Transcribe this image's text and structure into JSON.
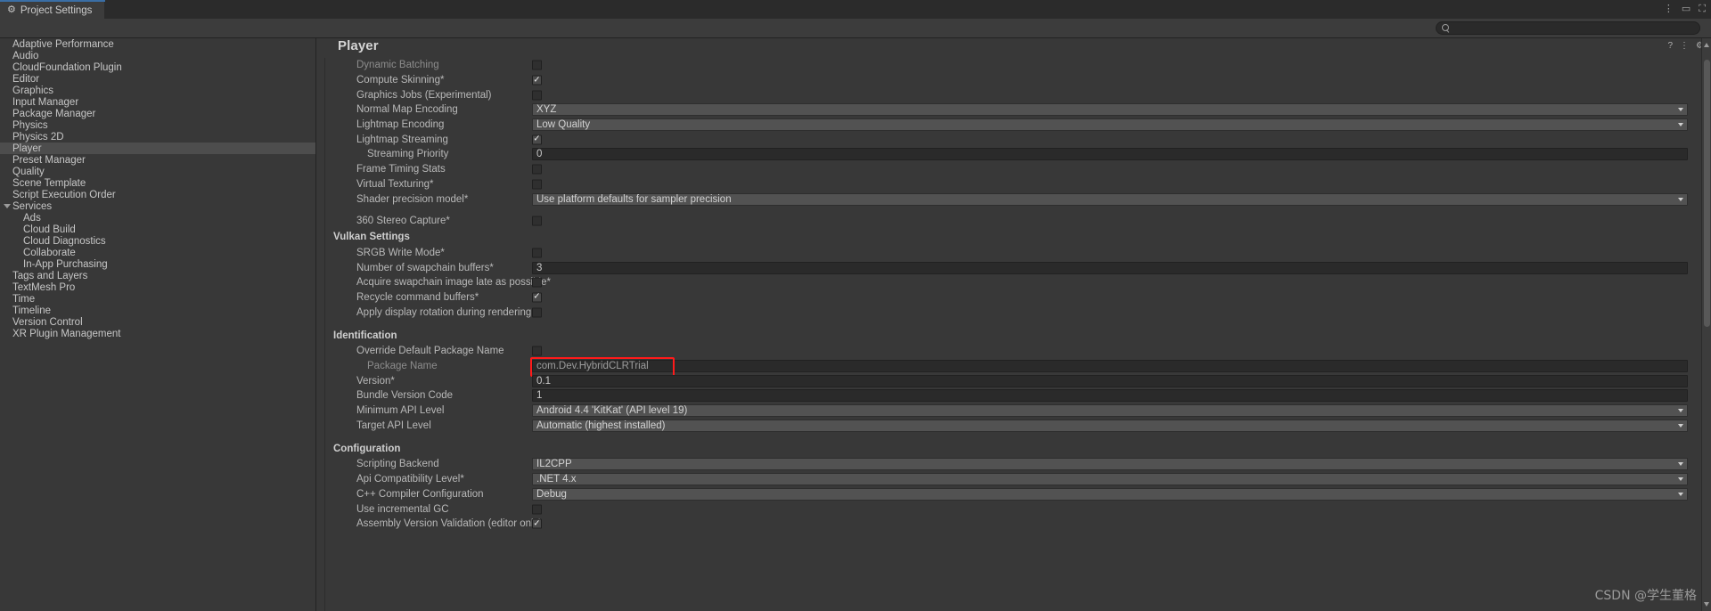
{
  "window": {
    "tab_label": "Project Settings",
    "tab_icon": "gear-icon",
    "menu_icon": "⋮",
    "minimize_icon": "▭",
    "maximize_icon": "⛶",
    "accent_color": "#3a6ea5"
  },
  "toolbar": {
    "search_value": "",
    "search_placeholder": ""
  },
  "sidebar": {
    "items": [
      {
        "label": "Adaptive Performance",
        "level": 0,
        "selected": false,
        "expandable": false
      },
      {
        "label": "Audio",
        "level": 0,
        "selected": false,
        "expandable": false
      },
      {
        "label": "CloudFoundation Plugin",
        "level": 0,
        "selected": false,
        "expandable": false
      },
      {
        "label": "Editor",
        "level": 0,
        "selected": false,
        "expandable": false
      },
      {
        "label": "Graphics",
        "level": 0,
        "selected": false,
        "expandable": false
      },
      {
        "label": "Input Manager",
        "level": 0,
        "selected": false,
        "expandable": false
      },
      {
        "label": "Package Manager",
        "level": 0,
        "selected": false,
        "expandable": false
      },
      {
        "label": "Physics",
        "level": 0,
        "selected": false,
        "expandable": false
      },
      {
        "label": "Physics 2D",
        "level": 0,
        "selected": false,
        "expandable": false
      },
      {
        "label": "Player",
        "level": 0,
        "selected": true,
        "expandable": false
      },
      {
        "label": "Preset Manager",
        "level": 0,
        "selected": false,
        "expandable": false
      },
      {
        "label": "Quality",
        "level": 0,
        "selected": false,
        "expandable": false
      },
      {
        "label": "Scene Template",
        "level": 0,
        "selected": false,
        "expandable": false
      },
      {
        "label": "Script Execution Order",
        "level": 0,
        "selected": false,
        "expandable": false
      },
      {
        "label": "Services",
        "level": 0,
        "selected": false,
        "expandable": true
      },
      {
        "label": "Ads",
        "level": 1,
        "selected": false,
        "expandable": false
      },
      {
        "label": "Cloud Build",
        "level": 1,
        "selected": false,
        "expandable": false
      },
      {
        "label": "Cloud Diagnostics",
        "level": 1,
        "selected": false,
        "expandable": false
      },
      {
        "label": "Collaborate",
        "level": 1,
        "selected": false,
        "expandable": false
      },
      {
        "label": "In-App Purchasing",
        "level": 1,
        "selected": false,
        "expandable": false
      },
      {
        "label": "Tags and Layers",
        "level": 0,
        "selected": false,
        "expandable": false
      },
      {
        "label": "TextMesh Pro",
        "level": 0,
        "selected": false,
        "expandable": false
      },
      {
        "label": "Time",
        "level": 0,
        "selected": false,
        "expandable": false
      },
      {
        "label": "Timeline",
        "level": 0,
        "selected": false,
        "expandable": false
      },
      {
        "label": "Version Control",
        "level": 0,
        "selected": false,
        "expandable": false
      },
      {
        "label": "XR Plugin Management",
        "level": 0,
        "selected": false,
        "expandable": false
      }
    ]
  },
  "main": {
    "title": "Player",
    "help_icon": "?",
    "menu_icon": "⋮",
    "settings_icon": "⚙",
    "rows": [
      {
        "kind": "toggle",
        "label": "Dynamic Batching",
        "indent": 2,
        "dim": true,
        "value": false
      },
      {
        "kind": "toggle",
        "label": "Compute Skinning*",
        "indent": 2,
        "dim": false,
        "value": true
      },
      {
        "kind": "toggle",
        "label": "Graphics Jobs (Experimental)",
        "indent": 2,
        "dim": false,
        "value": false
      },
      {
        "kind": "popup",
        "label": "Normal Map Encoding",
        "indent": 2,
        "dim": false,
        "value": "XYZ"
      },
      {
        "kind": "popup",
        "label": "Lightmap Encoding",
        "indent": 2,
        "dim": false,
        "value": "Low Quality"
      },
      {
        "kind": "toggle",
        "label": "Lightmap Streaming",
        "indent": 2,
        "dim": false,
        "value": true
      },
      {
        "kind": "text",
        "label": "Streaming Priority",
        "indent": 3,
        "dim": false,
        "value": "0"
      },
      {
        "kind": "toggle",
        "label": "Frame Timing Stats",
        "indent": 2,
        "dim": false,
        "value": false
      },
      {
        "kind": "toggle",
        "label": "Virtual Texturing*",
        "indent": 2,
        "dim": false,
        "value": false
      },
      {
        "kind": "popup",
        "label": "Shader precision model*",
        "indent": 2,
        "dim": false,
        "value": "Use platform defaults for sampler precision"
      },
      {
        "kind": "spacer"
      },
      {
        "kind": "toggle",
        "label": "360 Stereo Capture*",
        "indent": 2,
        "dim": false,
        "value": false
      },
      {
        "kind": "section",
        "label": "Vulkan Settings"
      },
      {
        "kind": "toggle",
        "label": "SRGB Write Mode*",
        "indent": 2,
        "dim": false,
        "value": false
      },
      {
        "kind": "text",
        "label": "Number of swapchain buffers*",
        "indent": 2,
        "dim": false,
        "value": "3"
      },
      {
        "kind": "toggle",
        "label": "Acquire swapchain image late as possible*",
        "indent": 2,
        "dim": false,
        "value": false
      },
      {
        "kind": "toggle",
        "label": "Recycle command buffers*",
        "indent": 2,
        "dim": false,
        "value": true
      },
      {
        "kind": "toggle",
        "label": "Apply display rotation during rendering",
        "indent": 2,
        "dim": false,
        "value": false
      },
      {
        "kind": "spacer"
      },
      {
        "kind": "section",
        "label": "Identification"
      },
      {
        "kind": "toggle",
        "label": "Override Default Package Name",
        "indent": 2,
        "dim": false,
        "value": false
      },
      {
        "kind": "text",
        "label": "Package Name",
        "indent": 3,
        "dim": true,
        "value": "com.Dev.HybridCLRTrial",
        "highlighted": true
      },
      {
        "kind": "text",
        "label": "Version*",
        "indent": 2,
        "dim": false,
        "value": "0.1"
      },
      {
        "kind": "text",
        "label": "Bundle Version Code",
        "indent": 2,
        "dim": false,
        "value": "1"
      },
      {
        "kind": "popup",
        "label": "Minimum API Level",
        "indent": 2,
        "dim": false,
        "value": "Android 4.4 'KitKat' (API level 19)"
      },
      {
        "kind": "popup",
        "label": "Target API Level",
        "indent": 2,
        "dim": false,
        "value": "Automatic (highest installed)"
      },
      {
        "kind": "spacer"
      },
      {
        "kind": "section",
        "label": "Configuration"
      },
      {
        "kind": "popup",
        "label": "Scripting Backend",
        "indent": 2,
        "dim": false,
        "value": "IL2CPP"
      },
      {
        "kind": "popup",
        "label": "Api Compatibility Level*",
        "indent": 2,
        "dim": false,
        "value": ".NET 4.x"
      },
      {
        "kind": "popup",
        "label": "C++ Compiler Configuration",
        "indent": 2,
        "dim": false,
        "value": "Debug"
      },
      {
        "kind": "toggle",
        "label": "Use incremental GC",
        "indent": 2,
        "dim": false,
        "value": false
      },
      {
        "kind": "toggle",
        "label": "Assembly Version Validation (editor only)",
        "indent": 2,
        "dim": false,
        "value": true
      }
    ]
  },
  "highlight": {
    "color": "#ff1a1a"
  },
  "watermark": {
    "text": "CSDN @学生董格"
  }
}
